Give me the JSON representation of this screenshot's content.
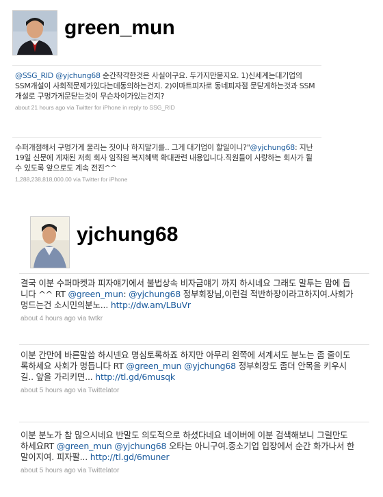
{
  "profile1": {
    "username": "green_mun",
    "tweets": [
      {
        "mention1": "@SSG_RID",
        "mention2": "@yjchung68",
        "body": " 순간착각한것은 사실이구요. 두가지만묻지요. 1)신세계는대기업의SSM개설이 사회적문제가있다는데동의하는건지. 2)이마트피자로 동네피자점 문닫게하는것과 SSM개설로 구멍가게문닫는것이 무슨차이가있는건지?",
        "meta": "about 21 hours ago via Twitter for iPhone in reply to SSG_RID"
      },
      {
        "body_pre": "수퍼개점해서 구멍가게 울리는 짓이나 하지말기를.. 그게 대기업이 할일이니?\"",
        "mention": "@yjchung68",
        "body_post": ": 지난 19일 신문에 게재된 저희 회사 임직원 복지혜택 확대관련 내용입니다.직원들이 사랑하는 회사가 될수 있도록 앞으로도 계속 전진^^",
        "meta": "1,288,238,818,000.00 via Twitter for iPhone"
      }
    ]
  },
  "profile2": {
    "username": "yjchung68",
    "tweets": [
      {
        "body_pre": "결국 이분 수퍼마켓과 피자얘기에서 불법상속 비자금얘기 까지 하시네요 그래도 말투는 맘에 듭니다 ^^ RT ",
        "mention1": "@green_mun",
        "body_mid": ": ",
        "mention2": "@yjchung68",
        "body_post": " 정부회장님,이런걸 적반하장이라고하지여.사회가 멍드는건 소시민의분노... ",
        "link": "http://dw.am/LBuVr",
        "meta": "about 4 hours ago via twtkr"
      },
      {
        "body_pre": "이분 간만에 바른말씀 하시넨요 명심토록하죠 하지만 아무리 왼쪽에 서계셔도 분노는 좀 줄이도록하세요 사회가 멍듭니다 RT ",
        "mention1": "@green_mun",
        "body_mid": " ",
        "mention2": "@yjchung68",
        "body_post": " 정부회장도 좀더 안목을 키우시길.. 앞을 가리키면... ",
        "link": "http://tl.gd/6musqk",
        "meta": "about 5 hours ago via Twittelator"
      },
      {
        "body_pre": "이분 분노가 참 많으시네요 반말도 의도적으로 하셨다네요 네이버에 이분 검색해보니 그럴만도 하세요RT ",
        "mention1": "@green_mun",
        "body_mid": " ",
        "mention2": "@yjchung68",
        "body_post": " 오타는 아니구여.중소기업 입장에서 순간 화가나서 한말이지여. 피자팔... ",
        "link": "http://tl.gd/6muner",
        "meta": "about 5 hours ago via Twittelator"
      }
    ]
  },
  "colors": {
    "link": "#1a5a9c",
    "meta": "#999999",
    "text": "#333333"
  }
}
